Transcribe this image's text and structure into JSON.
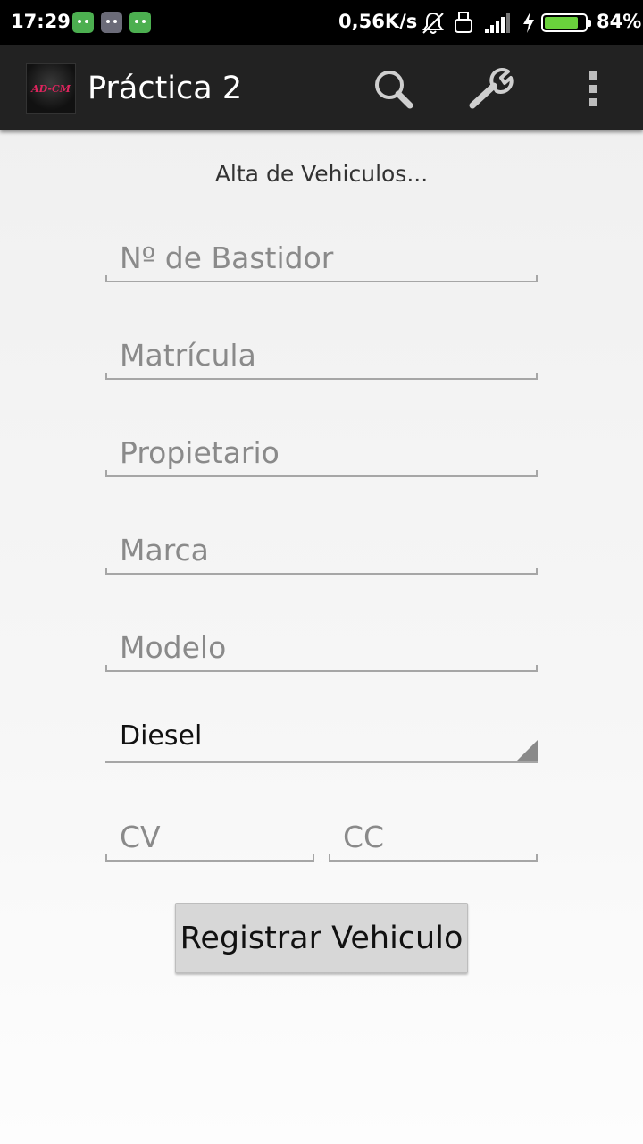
{
  "status_bar": {
    "time": "17:29",
    "network_speed": "0,56K/s",
    "battery_percent": "84%",
    "battery_level": 0.84,
    "icons": [
      "android-notification-icon",
      "notification-icon",
      "android-notification-icon",
      "bell-muted-icon",
      "usb-icon",
      "signal-icon",
      "charging-icon",
      "battery-icon"
    ]
  },
  "action_bar": {
    "title": "Práctica 2",
    "logo_text": "AD-CM",
    "actions": [
      "search-icon",
      "wrench-icon",
      "overflow-menu-icon"
    ]
  },
  "form": {
    "heading": "Alta de Vehiculos...",
    "fields": {
      "bastidor": {
        "placeholder": "Nº de Bastidor",
        "value": ""
      },
      "matricula": {
        "placeholder": "Matrícula",
        "value": ""
      },
      "propietario": {
        "placeholder": "Propietario",
        "value": ""
      },
      "marca": {
        "placeholder": "Marca",
        "value": ""
      },
      "modelo": {
        "placeholder": "Modelo",
        "value": ""
      },
      "cv": {
        "placeholder": "CV",
        "value": ""
      },
      "cc": {
        "placeholder": "CC",
        "value": ""
      }
    },
    "fuel_spinner": {
      "selected": "Diesel"
    },
    "submit_label": "Registrar Vehiculo"
  },
  "colors": {
    "action_bar": "#222222",
    "status_bar": "#000000",
    "battery_fill": "#6ad13c",
    "button_bg": "#d7d7d7"
  }
}
